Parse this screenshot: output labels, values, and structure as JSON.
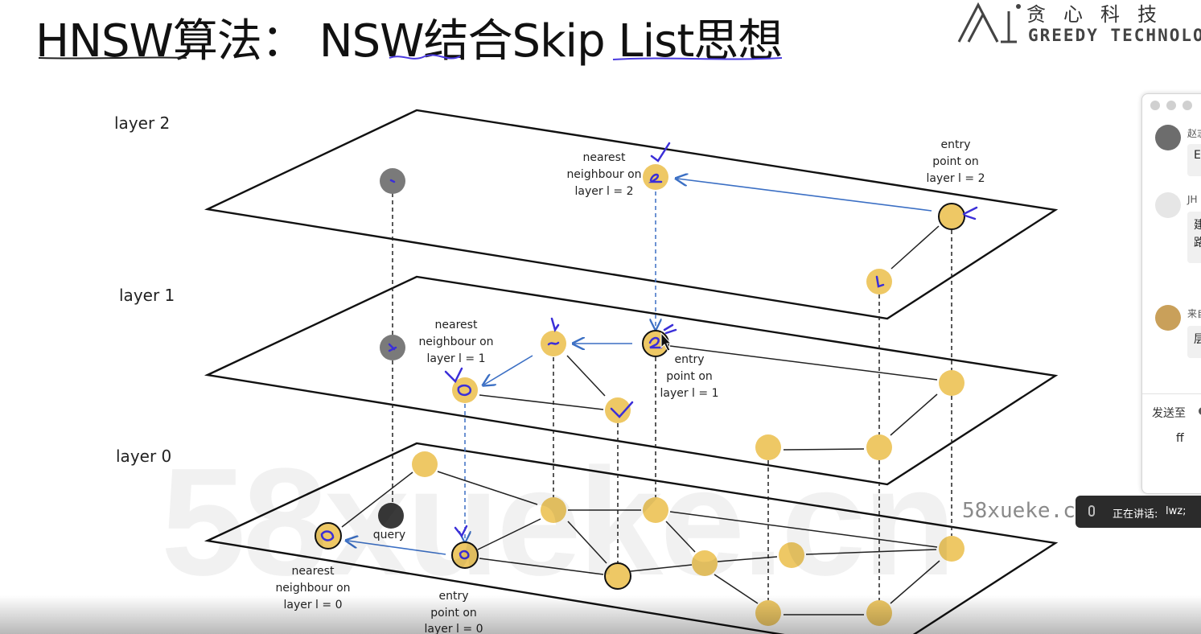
{
  "slide": {
    "title": "HNSW算法： NSW结合Skip List思想",
    "logo": {
      "chinese": "贪心科技",
      "english": "GREEDY TECHNOLOG"
    },
    "watermark": "58xueke.cn",
    "watermark_small": "58xueke.cn"
  },
  "diagram": {
    "layers": [
      {
        "label": "layer 2"
      },
      {
        "label": "layer 1"
      },
      {
        "label": "layer 0"
      }
    ],
    "annotations": {
      "nearest_l2": [
        "nearest",
        "neighbour on",
        "layer l = 2"
      ],
      "entry_l2": [
        "entry",
        "point on",
        "layer l = 2"
      ],
      "nearest_l1": [
        "nearest",
        "neighbour on",
        "layer l = 1"
      ],
      "entry_l1": [
        "entry",
        "point on",
        "layer l = 1"
      ],
      "nearest_l0": [
        "nearest",
        "neighbour on",
        "layer l = 0"
      ],
      "entry_l0": [
        "entry",
        "point on",
        "layer l = 0"
      ],
      "query": "query"
    },
    "colors": {
      "node": "#eec865",
      "query_node": "#3a3a3a",
      "grey_node": "#7a7a7a",
      "arrow": "#3b6fc4",
      "handwriting": "#3b2fd8"
    }
  },
  "chat": {
    "messages": [
      {
        "sender": "赵志",
        "text": "E"
      },
      {
        "sender": "JH",
        "text": "建\n路"
      },
      {
        "sender": "来自",
        "text": "层"
      }
    ],
    "send_to_label": "发送至",
    "input_text": "ff"
  },
  "status": {
    "speaking_label": "正在讲话:",
    "speaker": "lwz;"
  }
}
